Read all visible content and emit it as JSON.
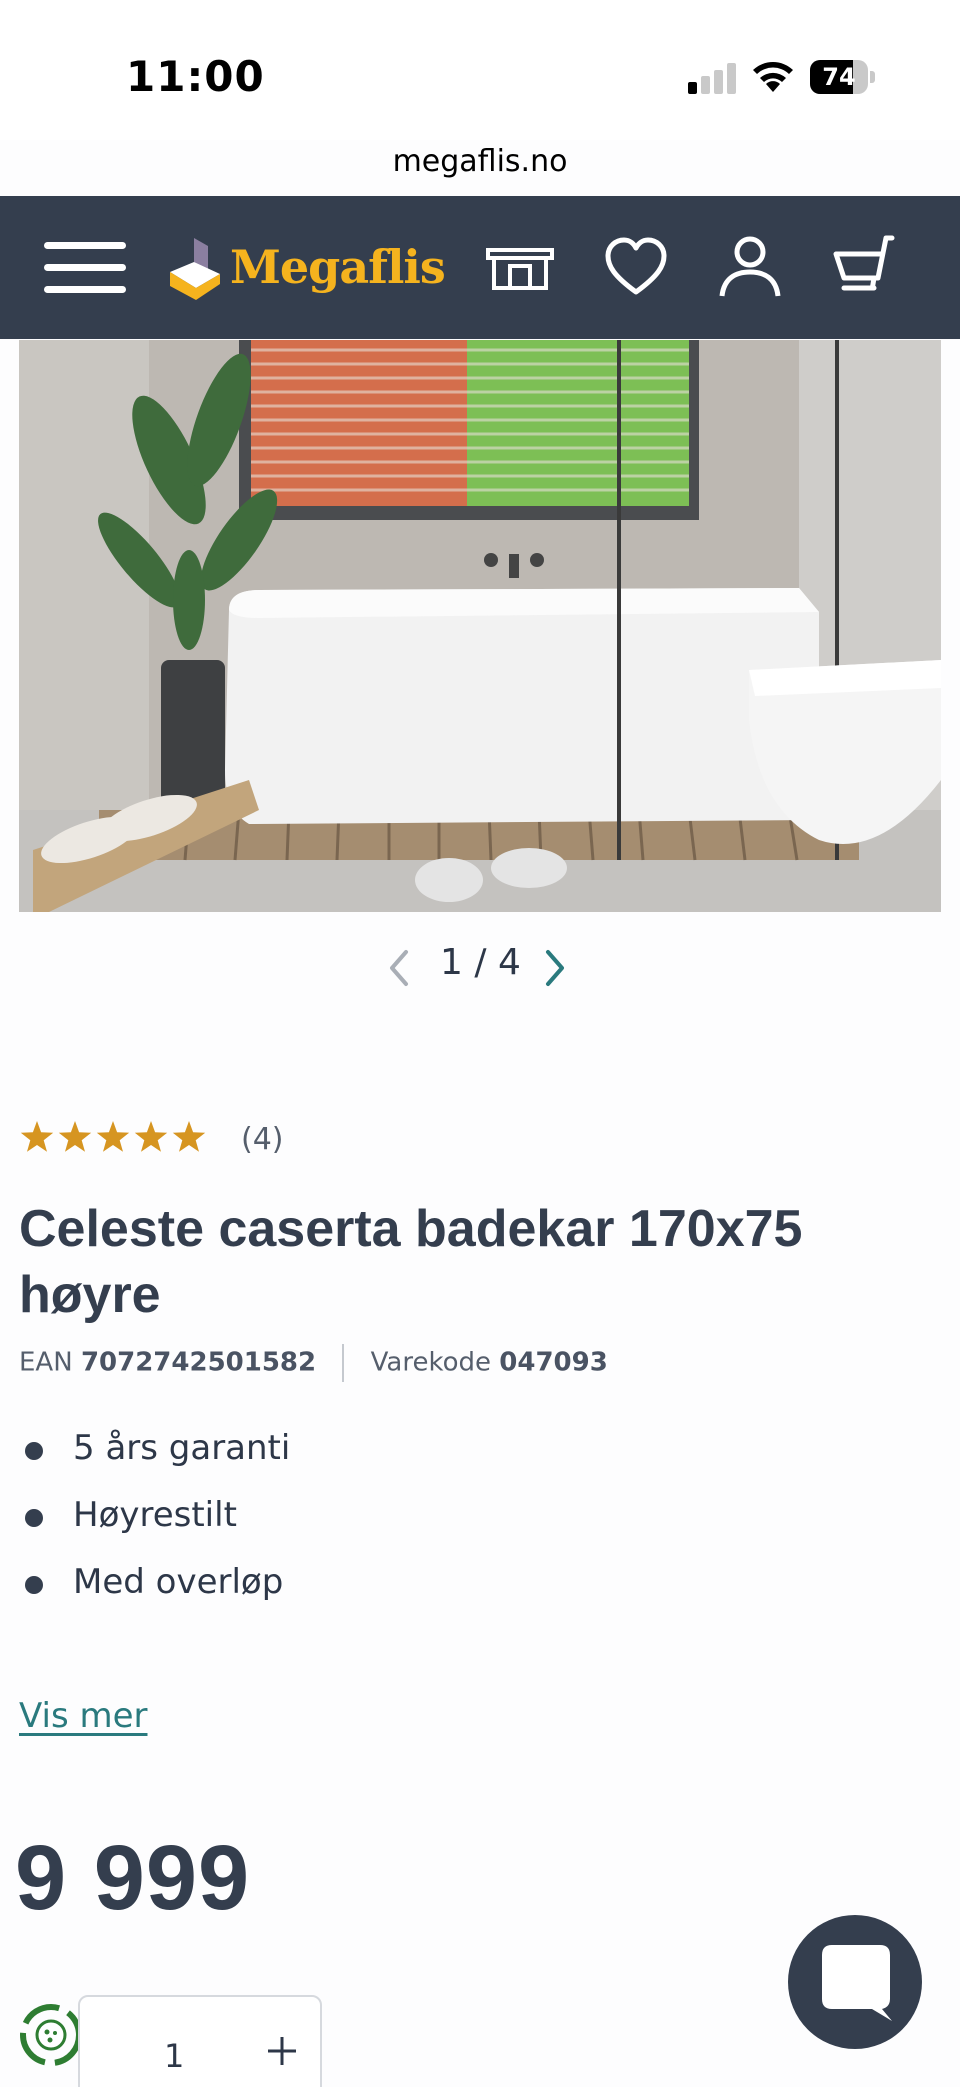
{
  "status_bar": {
    "time": "11:00",
    "battery": "74",
    "battery_level": 0.74
  },
  "browser": {
    "url": "megaflis.no"
  },
  "header": {
    "logo_text": "Megaflis",
    "icons": [
      "menu-icon",
      "showroom-icon",
      "heart-icon",
      "user-icon",
      "cart-icon"
    ]
  },
  "gallery": {
    "current": "1",
    "separator": "/",
    "total": "4"
  },
  "product": {
    "rating_count": "(4)",
    "stars": 5,
    "title_line1": "Celeste caserta badekar 170x75",
    "title_line2": "høyre",
    "ean_label": "EAN",
    "ean": "7072742501582",
    "sku_label": "Varekode",
    "sku": "047093",
    "features": [
      "5 års garanti",
      "Høyrestilt",
      "Med overløp"
    ],
    "more_link": "Vis mer",
    "price": "9 999",
    "quantity": "1"
  },
  "colors": {
    "header_bg": "#343e4e",
    "logo": "#f5b31e",
    "star": "#d69521",
    "link": "#2a7a7e"
  }
}
